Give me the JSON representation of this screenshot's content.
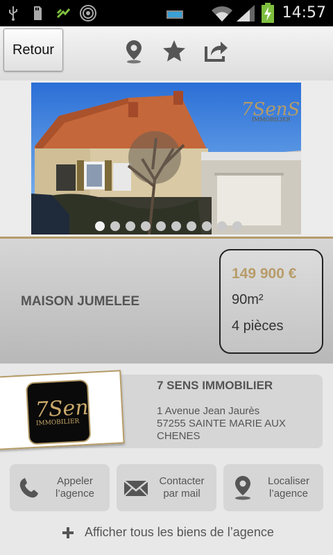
{
  "status_bar": {
    "time": "14:57",
    "icons": [
      "usb-icon",
      "sd-card-icon",
      "debug-icon",
      "signal-ring-icon",
      "battery-indicator-icon",
      "wifi-icon",
      "cell-signal-icon",
      "battery-charging-icon"
    ]
  },
  "toolbar": {
    "back_label": "Retour",
    "icons": [
      "location-pin-icon",
      "favorite-add-icon",
      "share-icon"
    ]
  },
  "gallery": {
    "image_count": 10,
    "active_index": 0,
    "watermark_line1": "7SenS",
    "watermark_line2": "IMMOBILIER"
  },
  "property": {
    "title": "MAISON JUMELEE",
    "price": "149 900 €",
    "surface": "90m²",
    "rooms": "4 pièces"
  },
  "agency": {
    "logo_text1": "7Sens",
    "logo_text2": "IMMOBILIER",
    "name": "7 SENS IMMOBILIER",
    "address_line1": "1 Avenue Jean Jaurès",
    "address_line2": "57255 SAINTE MARIE AUX",
    "address_line3": "CHENES"
  },
  "actions": {
    "call_line1": "Appeler",
    "call_line2": "l’agence",
    "mail_line1": "Contacter",
    "mail_line2": "par mail",
    "locate_line1": "Localiser",
    "locate_line2": "l’agence",
    "all_listings": "Afficher tous les biens de l’agence"
  },
  "colors": {
    "accent_gold": "#b59c68",
    "text_gray": "#555555"
  }
}
